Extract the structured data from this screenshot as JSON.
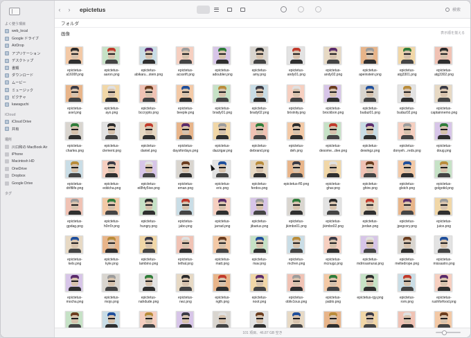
{
  "window": {
    "title": "epictetus"
  },
  "sidebar": {
    "sections": [
      {
        "title": "よく使う項目",
        "items": [
          {
            "label": "web_local",
            "icon": "folder-icon"
          },
          {
            "label": "Google ドライブ",
            "icon": "folder-icon"
          },
          {
            "label": "AirDrop",
            "icon": "airdrop-icon"
          },
          {
            "label": "アプリケーション",
            "icon": "folder-icon"
          },
          {
            "label": "デスクトップ",
            "icon": "folder-icon"
          },
          {
            "label": "書類",
            "icon": "folder-icon"
          },
          {
            "label": "ダウンロード",
            "icon": "folder-icon"
          },
          {
            "label": "ムービー",
            "icon": "folder-icon"
          },
          {
            "label": "ミュージック",
            "icon": "folder-icon"
          },
          {
            "label": "ピクチャ",
            "icon": "folder-icon"
          },
          {
            "label": "kawaguchi",
            "icon": "home-icon"
          }
        ]
      },
      {
        "title": "iCloud",
        "items": [
          {
            "label": "iCloud Drive",
            "icon": "cloud-icon"
          },
          {
            "label": "共有",
            "icon": "folder-icon"
          }
        ]
      },
      {
        "title": "場所",
        "items": [
          {
            "label": "川口和の MacBook Air",
            "icon": "laptop-icon"
          },
          {
            "label": "iPhone",
            "icon": "phone-icon"
          },
          {
            "label": "Macintosh HD",
            "icon": "disk-icon"
          },
          {
            "label": "OneDrive",
            "icon": "disk-icon"
          },
          {
            "label": "Dropbox",
            "icon": "disk-icon"
          },
          {
            "label": "Google Drive",
            "icon": "disk-icon"
          }
        ]
      },
      {
        "title": "タグ",
        "items": []
      }
    ]
  },
  "content": {
    "folder_section": "フォルダ",
    "images_section": "画像",
    "sort_label": "表示順を揃える"
  },
  "status": {
    "text": "101 項目、46.87 GB 空き"
  },
  "files": [
    "epictetus-\na1600f.png",
    "epictetus-\naaron.png",
    "epictetus-\nabikaru...stein.png",
    "epictetus-\nacssrift.png",
    "epictetus-\nadoubler.png",
    "epictetus-\namy.png",
    "epictetus-\nandy01.png",
    "epictetus-\nandy02.png",
    "epictetus-\napeinstein.png",
    "epictetus-\natg3301.png",
    "epictetus-\natg3302.png",
    "epictetus-\naxel.png",
    "epictetus-\nayo.png",
    "epictetus-\nbccrypto.png",
    "epictetus-\nbeeple.png",
    "epictetus-\nbrady01.png",
    "epictetus-\nbrady02.png",
    "epictetus-\nbrixinity.png",
    "epictetus-\nbrockbon.png",
    "epictetus-\nbudaz01.png",
    "epictetus-\nbudaz02.png",
    "epictetus-\ncaptainnemo.png",
    "epictetus-\ncharles.png",
    "epictetus-\nclement.png",
    "epictetus-\ndaniel.png",
    "epictetus-\ndaysfordays.png",
    "epictetus-\ndazzigar.png",
    "epictetus-\ndebrand.png",
    "epictetus-\ndeh.png",
    "epictetus-\ndesome...dee.png",
    "epictetus-\ndewingz.png",
    "epictetus-\ndonyeh...reds.png",
    "epictetus-\ndoug.png",
    "epictetus-\ndriftlife.png",
    "epictetus-\neddcha.png",
    "epictetus-\nei8hty5ive.png",
    "epictetus-\neman.png",
    "epictetus-\neric.png",
    "epictetus-\nferdos.png",
    "epictetus-fl0.png",
    "epictetus-\nghar.png",
    "epictetus-\nghire.png",
    "epictetus-\nglstch.png",
    "epictetus-\ngolgotid.png",
    "epictetus-\ngpdag.png",
    "epictetus-\nh0rr0r.png",
    "epictetus-\nhungry.png",
    "epictetus-\njabo.png",
    "epictetus-\njarrad.png",
    "epictetus-\njibarius.png",
    "epictetus-\njkimbo01.png",
    "epictetus-\njkimbo02.png",
    "epictetus-\njordan.png",
    "epictetus-\njpegcory.png",
    "epictetus-\njuice.png",
    "epictetus-\nkels.png",
    "epictetus-\nkyle.png",
    "epictetus-\nlambino.png",
    "epictetus-\nlethal.png",
    "epictetus-\nmatt.png",
    "epictetus-\nmav.png",
    "epictetus-\nmcfren.png",
    "epictetus-\nmcnugz.png",
    "epictetus-\nmdrnsamurai.png",
    "epictetus-\nmeltedrope.png",
    "epictetus-\nmissastro.png",
    "epictetus-\nmocha.png",
    "epictetus-\nmojo.png",
    "epictetus-\nnahdude.png",
    "epictetus-\nnez.png",
    "epictetus-\nngth.png",
    "epictetus-\nnoot.png",
    "epictetus-\nobliv1ous.png",
    "epictetus-\npablo.png",
    "epictetus-rgy.png",
    "epictetus-\nrom.png",
    "epictetus-\nrushforfood.png",
    "",
    "",
    "",
    "",
    "",
    "",
    "",
    "",
    "",
    "",
    ""
  ],
  "palette": {
    "backgrounds": [
      "#f3c9a6",
      "#e8b58a",
      "#d9d5cf",
      "#c9dde6",
      "#f0c2b4",
      "#e7d9c4",
      "#d7c5e8",
      "#c6e2c6",
      "#f1d7a7",
      "#e3e3e3",
      "#f6cfc0"
    ],
    "hair": [
      "#2b2b2b",
      "#6b3d1f",
      "#9c9c9c",
      "#3b3b46",
      "#c13a2b",
      "#1f4f9c",
      "#2f7d3a",
      "#e0e0e0",
      "#5a2b6b",
      "#b98c3a"
    ],
    "body": [
      "#2e5fb0",
      "#c0392b",
      "#2f2f2f",
      "#e6e6e6",
      "#3d8b3d",
      "#7a3d9c",
      "#d98c2b",
      "#444444",
      "#1f8c8c",
      "#b03060"
    ]
  }
}
